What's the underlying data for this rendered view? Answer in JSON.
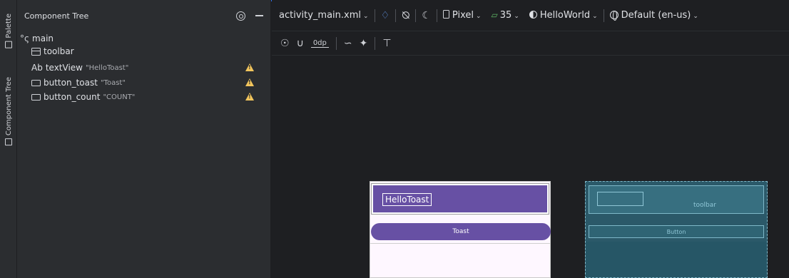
{
  "palette_tab": {
    "label": "Palette"
  },
  "component_tree_tab": {
    "label": "Component Tree"
  },
  "tree_panel": {
    "title": "Component Tree",
    "nodes": [
      {
        "label": "main",
        "attr": ""
      },
      {
        "label": "toolbar",
        "attr": ""
      },
      {
        "label": "textView",
        "attr": "\"HelloToast\"",
        "warning": true
      },
      {
        "label": "button_toast",
        "attr": "\"Toast\"",
        "warning": true
      },
      {
        "label": "button_count",
        "attr": "\"COUNT\"",
        "warning": true
      }
    ],
    "text_prefix": "Ab"
  },
  "editor_toolbar": {
    "file": "activity_main.xml",
    "device": "Pixel",
    "api_level": "35",
    "theme": "HelloWorld",
    "locale": "Default (en-us)"
  },
  "design_toolbar": {
    "margin": "0dp"
  },
  "design_preview": {
    "title": "HelloToast",
    "button_label": "Toast"
  },
  "blueprint_preview": {
    "toolbar_label": "toolbar",
    "button_label": "Button"
  },
  "colors": {
    "accent": "#3574f0",
    "warning": "#f2c55c",
    "primary": "#6750a4",
    "blueprint": "#2b5969"
  }
}
